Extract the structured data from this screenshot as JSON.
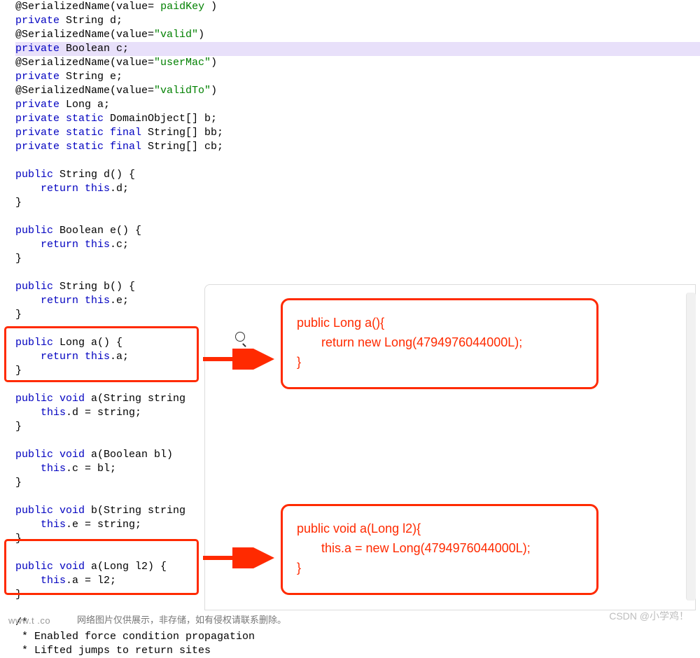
{
  "code_lines": [
    {
      "h": false,
      "tokens": [
        {
          "c": "plain",
          "t": "@"
        },
        {
          "c": "type",
          "t": "SerializedName"
        },
        {
          "c": "plain",
          "t": "("
        },
        {
          "c": "type",
          "t": "value"
        },
        {
          "c": "plain",
          "t": "= "
        },
        {
          "c": "str",
          "t": "paidKey"
        },
        {
          "c": "plain",
          "t": " )"
        }
      ]
    },
    {
      "h": false,
      "tokens": [
        {
          "c": "kw",
          "t": "private"
        },
        {
          "c": "plain",
          "t": " String d;"
        }
      ]
    },
    {
      "h": false,
      "tokens": [
        {
          "c": "plain",
          "t": "@SerializedName(value="
        },
        {
          "c": "str",
          "t": "\"valid\""
        },
        {
          "c": "plain",
          "t": ")"
        }
      ]
    },
    {
      "h": true,
      "tokens": [
        {
          "c": "kw",
          "t": "private"
        },
        {
          "c": "plain",
          "t": " Boolean c;"
        }
      ]
    },
    {
      "h": false,
      "tokens": [
        {
          "c": "plain",
          "t": "@SerializedName(value="
        },
        {
          "c": "str",
          "t": "\"userMac\""
        },
        {
          "c": "plain",
          "t": ")"
        }
      ]
    },
    {
      "h": false,
      "tokens": [
        {
          "c": "kw",
          "t": "private"
        },
        {
          "c": "plain",
          "t": " String e;"
        }
      ]
    },
    {
      "h": false,
      "tokens": [
        {
          "c": "plain",
          "t": "@SerializedName(value="
        },
        {
          "c": "str",
          "t": "\"validTo\""
        },
        {
          "c": "plain",
          "t": ")"
        }
      ]
    },
    {
      "h": false,
      "tokens": [
        {
          "c": "kw",
          "t": "private"
        },
        {
          "c": "plain",
          "t": " Long a;"
        }
      ]
    },
    {
      "h": false,
      "tokens": [
        {
          "c": "kw",
          "t": "private static"
        },
        {
          "c": "plain",
          "t": " DomainObject[] b;"
        }
      ]
    },
    {
      "h": false,
      "tokens": [
        {
          "c": "kw",
          "t": "private static final"
        },
        {
          "c": "plain",
          "t": " String[] bb;"
        }
      ]
    },
    {
      "h": false,
      "tokens": [
        {
          "c": "kw",
          "t": "private static final"
        },
        {
          "c": "plain",
          "t": " String[] cb;"
        }
      ]
    },
    {
      "h": false,
      "tokens": [
        {
          "c": "plain",
          "t": ""
        }
      ]
    },
    {
      "h": false,
      "tokens": [
        {
          "c": "kw",
          "t": "public"
        },
        {
          "c": "plain",
          "t": " String d() {"
        }
      ]
    },
    {
      "h": false,
      "tokens": [
        {
          "c": "guide",
          "t": "    "
        },
        {
          "c": "kw",
          "t": "return this"
        },
        {
          "c": "plain",
          "t": ".d;"
        }
      ]
    },
    {
      "h": false,
      "tokens": [
        {
          "c": "plain",
          "t": "}"
        }
      ]
    },
    {
      "h": false,
      "tokens": [
        {
          "c": "plain",
          "t": ""
        }
      ]
    },
    {
      "h": false,
      "tokens": [
        {
          "c": "kw",
          "t": "public"
        },
        {
          "c": "plain",
          "t": " Boolean e() {"
        }
      ]
    },
    {
      "h": false,
      "tokens": [
        {
          "c": "guide",
          "t": "    "
        },
        {
          "c": "kw",
          "t": "return this"
        },
        {
          "c": "plain",
          "t": ".c;"
        }
      ]
    },
    {
      "h": false,
      "tokens": [
        {
          "c": "plain",
          "t": "}"
        }
      ]
    },
    {
      "h": false,
      "tokens": [
        {
          "c": "plain",
          "t": ""
        }
      ]
    },
    {
      "h": false,
      "tokens": [
        {
          "c": "kw",
          "t": "public"
        },
        {
          "c": "plain",
          "t": " String b() {"
        }
      ]
    },
    {
      "h": false,
      "tokens": [
        {
          "c": "guide",
          "t": "    "
        },
        {
          "c": "kw",
          "t": "return this"
        },
        {
          "c": "plain",
          "t": ".e;"
        }
      ]
    },
    {
      "h": false,
      "tokens": [
        {
          "c": "plain",
          "t": "}"
        }
      ]
    },
    {
      "h": false,
      "tokens": [
        {
          "c": "plain",
          "t": ""
        }
      ]
    },
    {
      "h": false,
      "tokens": [
        {
          "c": "kw",
          "t": "public"
        },
        {
          "c": "plain",
          "t": " Long a() {"
        }
      ]
    },
    {
      "h": false,
      "tokens": [
        {
          "c": "guide",
          "t": "    "
        },
        {
          "c": "kw",
          "t": "return this"
        },
        {
          "c": "plain",
          "t": ".a;"
        }
      ]
    },
    {
      "h": false,
      "tokens": [
        {
          "c": "plain",
          "t": "}"
        }
      ]
    },
    {
      "h": false,
      "tokens": [
        {
          "c": "plain",
          "t": ""
        }
      ]
    },
    {
      "h": false,
      "tokens": [
        {
          "c": "kw",
          "t": "public void"
        },
        {
          "c": "plain",
          "t": " a(String string"
        }
      ]
    },
    {
      "h": false,
      "tokens": [
        {
          "c": "guide",
          "t": "    "
        },
        {
          "c": "kw",
          "t": "this"
        },
        {
          "c": "plain",
          "t": ".d = string;"
        }
      ]
    },
    {
      "h": false,
      "tokens": [
        {
          "c": "plain",
          "t": "}"
        }
      ]
    },
    {
      "h": false,
      "tokens": [
        {
          "c": "plain",
          "t": ""
        }
      ]
    },
    {
      "h": false,
      "tokens": [
        {
          "c": "kw",
          "t": "public void"
        },
        {
          "c": "plain",
          "t": " a(Boolean bl) "
        }
      ]
    },
    {
      "h": false,
      "tokens": [
        {
          "c": "guide",
          "t": "    "
        },
        {
          "c": "kw",
          "t": "this"
        },
        {
          "c": "plain",
          "t": ".c = bl;"
        }
      ]
    },
    {
      "h": false,
      "tokens": [
        {
          "c": "plain",
          "t": "}"
        }
      ]
    },
    {
      "h": false,
      "tokens": [
        {
          "c": "plain",
          "t": ""
        }
      ]
    },
    {
      "h": false,
      "tokens": [
        {
          "c": "kw",
          "t": "public void"
        },
        {
          "c": "plain",
          "t": " b(String string"
        }
      ]
    },
    {
      "h": false,
      "tokens": [
        {
          "c": "guide",
          "t": "    "
        },
        {
          "c": "kw",
          "t": "this"
        },
        {
          "c": "plain",
          "t": ".e = string;"
        }
      ]
    },
    {
      "h": false,
      "tokens": [
        {
          "c": "plain",
          "t": "}"
        }
      ]
    },
    {
      "h": false,
      "tokens": [
        {
          "c": "plain",
          "t": ""
        }
      ]
    },
    {
      "h": false,
      "tokens": [
        {
          "c": "kw",
          "t": "public void"
        },
        {
          "c": "plain",
          "t": " a(Long l2) {"
        }
      ]
    },
    {
      "h": false,
      "tokens": [
        {
          "c": "guide",
          "t": "    "
        },
        {
          "c": "kw",
          "t": "this"
        },
        {
          "c": "plain",
          "t": ".a = l2;"
        }
      ]
    },
    {
      "h": false,
      "tokens": [
        {
          "c": "plain",
          "t": "}"
        }
      ]
    },
    {
      "h": false,
      "tokens": [
        {
          "c": "plain",
          "t": ""
        }
      ]
    },
    {
      "h": false,
      "tokens": [
        {
          "c": "plain",
          "t": "/*"
        }
      ]
    },
    {
      "h": false,
      "tokens": [
        {
          "c": "plain",
          "t": " * Enabled force condition propagation"
        }
      ]
    },
    {
      "h": false,
      "tokens": [
        {
          "c": "plain",
          "t": " * Lifted jumps to return sites"
        }
      ]
    }
  ],
  "callouts": {
    "c1_line1": "public Long a(){",
    "c1_line2": "       return new Long(4794976044000L);",
    "c1_line3": "}",
    "c2_line1": "public void a(Long l2){",
    "c2_line2": "       this.a = new Long(4794976044000L);",
    "c2_line3": "}"
  },
  "watermark_left": "www.t          .co",
  "caption": "网络图片仅供展示，非存储，如有侵权请联系删除。",
  "csdn": "CSDN @小学鸡！"
}
